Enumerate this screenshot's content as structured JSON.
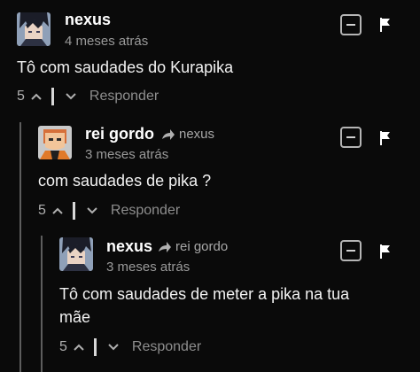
{
  "comments": [
    {
      "username": "nexus",
      "reply_to": "",
      "timestamp": "4 meses atrás",
      "body": "Tô com saudades do Kurapika",
      "votes": "5",
      "reply_label": "Responder"
    },
    {
      "username": "rei gordo",
      "reply_to": "nexus",
      "timestamp": "3 meses atrás",
      "body": "com saudades de pika ?",
      "votes": "5",
      "reply_label": "Responder"
    },
    {
      "username": "nexus",
      "reply_to": "rei gordo",
      "timestamp": "3 meses atrás",
      "body": "Tô com saudades de meter a pika na tua mãe",
      "votes": "5",
      "reply_label": "Responder"
    }
  ],
  "colors": {
    "background": "#0a0a0a",
    "text": "#ffffff",
    "muted": "#9a9a9a",
    "thread_line": "#5d5d5d"
  },
  "icons": {
    "collapse": "minus-square-icon",
    "flag": "flag-icon",
    "upvote": "chevron-up-icon",
    "downvote": "chevron-down-icon",
    "reply_arrow": "reply-arrow-icon"
  }
}
